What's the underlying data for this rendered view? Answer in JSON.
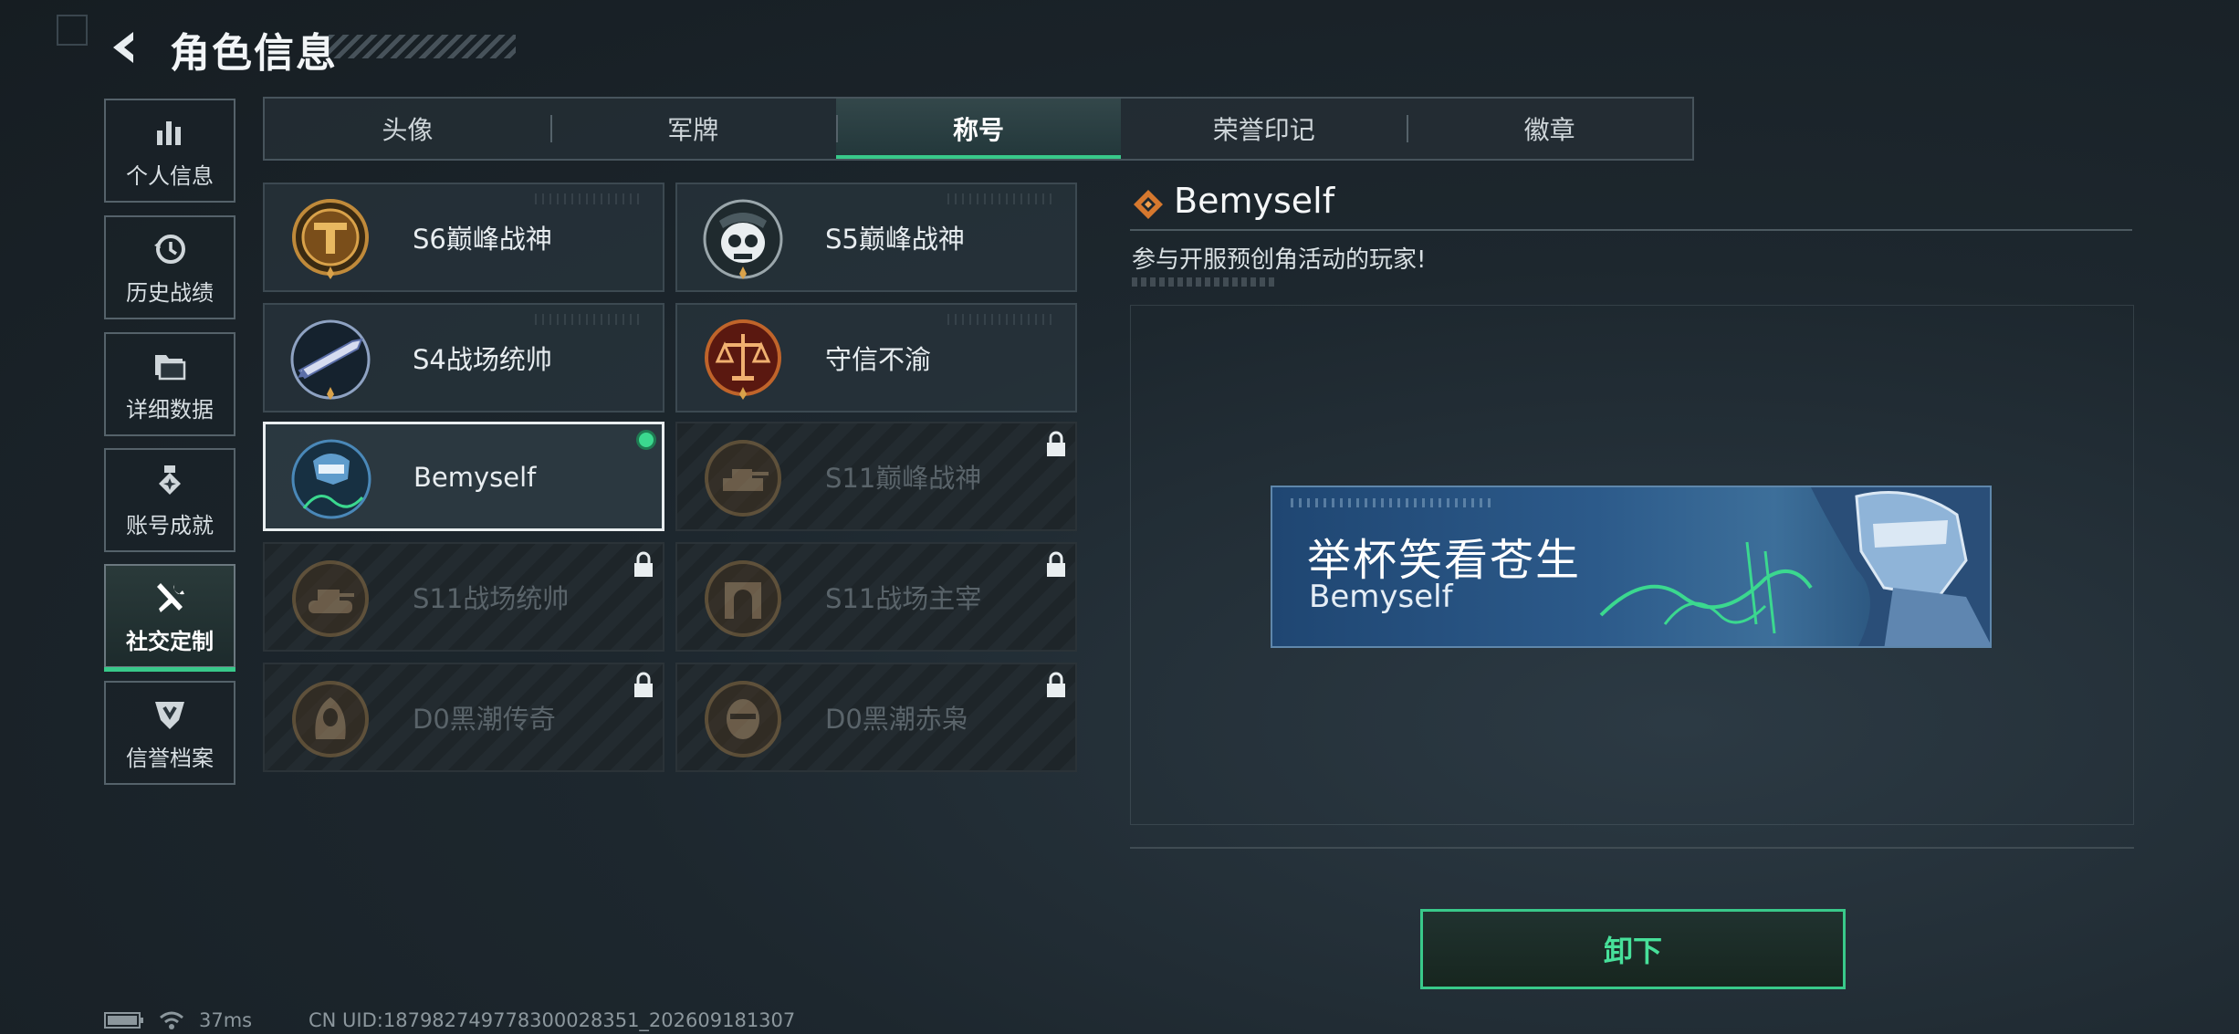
{
  "header": {
    "title": "角色信息",
    "back_icon": "back-arrow-icon"
  },
  "sidebar": {
    "items": [
      {
        "label": "个人信息",
        "icon": "bar-chart-icon",
        "active": false
      },
      {
        "label": "历史战绩",
        "icon": "clock-history-icon",
        "active": false
      },
      {
        "label": "详细数据",
        "icon": "folder-icon",
        "active": false
      },
      {
        "label": "账号成就",
        "icon": "medal-icon",
        "active": false
      },
      {
        "label": "社交定制",
        "icon": "tools-icon",
        "active": true
      },
      {
        "label": "信誉档案",
        "icon": "credit-shield-icon",
        "active": false
      }
    ]
  },
  "tabs": [
    {
      "label": "头像",
      "active": false
    },
    {
      "label": "军牌",
      "active": false
    },
    {
      "label": "称号",
      "active": true
    },
    {
      "label": "荣誉印记",
      "active": false
    },
    {
      "label": "徽章",
      "active": false
    }
  ],
  "titles": [
    {
      "name": "S6巅峰战神",
      "emblem": "gold-t-emblem-icon",
      "state": "unlocked"
    },
    {
      "name": "S5巅峰战神",
      "emblem": "skull-emblem-icon",
      "state": "unlocked"
    },
    {
      "name": "S4战场统帅",
      "emblem": "missile-emblem-icon",
      "state": "unlocked"
    },
    {
      "name": "守信不渝",
      "emblem": "scales-emblem-icon",
      "state": "unlocked"
    },
    {
      "name": "Bemyself",
      "emblem": "soldier-signature-emblem-icon",
      "state": "equipped"
    },
    {
      "name": "S11巅峰战神",
      "emblem": "tank-emblem-icon",
      "state": "locked"
    },
    {
      "name": "S11战场统帅",
      "emblem": "tank-emblem-icon",
      "state": "locked"
    },
    {
      "name": "S11战场主宰",
      "emblem": "arch-emblem-icon",
      "state": "locked"
    },
    {
      "name": "D0黑潮传奇",
      "emblem": "hooded-figure-emblem-icon",
      "state": "locked"
    },
    {
      "name": "D0黑潮赤枭",
      "emblem": "masked-face-emblem-icon",
      "state": "locked"
    }
  ],
  "detail": {
    "name": "Bemyself",
    "description": "参与开服预创角活动的玩家!",
    "banner": {
      "title": "举杯笑看苍生",
      "subtitle": "Bemyself"
    },
    "unequip_label": "卸下"
  },
  "status_bar": {
    "ping": "37ms",
    "uid": "CN UID:18798274977830002835​1_202609181307"
  },
  "colors": {
    "accent_green": "#38c98a",
    "equipped_dot": "#3bd88f",
    "banner_blue": "#2c5a8a",
    "gold": "#c08a3a"
  }
}
